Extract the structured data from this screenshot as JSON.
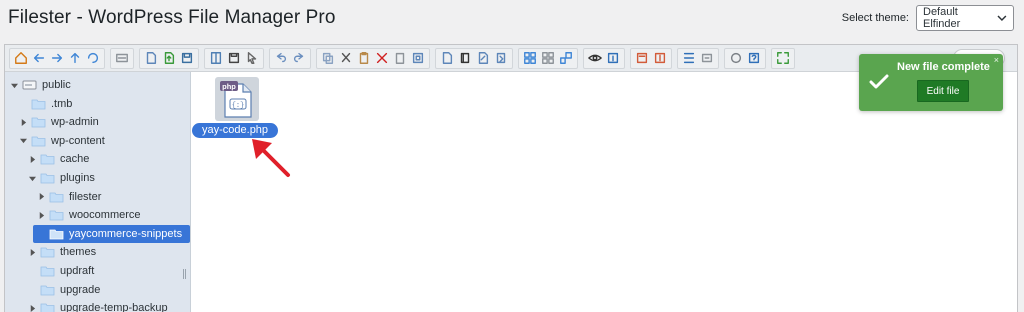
{
  "header": {
    "title": "Filester - WordPress File Manager Pro",
    "theme_label": "Select theme:",
    "theme_value": "Default Elfinder"
  },
  "toolbar": {
    "groups": [
      [
        "home-icon",
        "back-icon",
        "forward-icon",
        "up-icon",
        "reload-icon"
      ],
      [
        "mkdir-icon"
      ],
      [
        "mkfile-icon",
        "upload-icon",
        "save-icon"
      ],
      [
        "open-icon",
        "download-icon",
        "select-icon"
      ],
      [
        "undo-icon",
        "redo-icon"
      ],
      [
        "copy-icon",
        "cut-icon",
        "paste-icon",
        "delete-icon",
        "empty-icon",
        "duplicate-icon"
      ],
      [
        "rename-icon",
        "edit-icon",
        "resize-icon",
        "extract-icon"
      ],
      [
        "view-icons-icon",
        "view-list-icon",
        "sort-icon"
      ],
      [
        "preview-icon",
        "info-icon"
      ],
      [
        "archive-icon",
        "extract-archive-icon"
      ],
      [
        "places-icon",
        "netmount-icon"
      ],
      [
        "settings-icon",
        "help-icon"
      ],
      [
        "fullscreen-icon"
      ]
    ]
  },
  "tree": {
    "items": [
      {
        "label": "public",
        "depth": 0,
        "arrow": "open",
        "icon": "drive"
      },
      {
        "label": ".tmb",
        "depth": 1,
        "arrow": "none",
        "icon": "folder"
      },
      {
        "label": "wp-admin",
        "depth": 1,
        "arrow": "closed",
        "icon": "folder"
      },
      {
        "label": "wp-content",
        "depth": 1,
        "arrow": "open",
        "icon": "folder"
      },
      {
        "label": "cache",
        "depth": 2,
        "arrow": "closed",
        "icon": "folder"
      },
      {
        "label": "plugins",
        "depth": 2,
        "arrow": "open",
        "icon": "folder"
      },
      {
        "label": "filester",
        "depth": 3,
        "arrow": "closed",
        "icon": "folder"
      },
      {
        "label": "woocommerce",
        "depth": 3,
        "arrow": "closed",
        "icon": "folder"
      },
      {
        "label": "yaycommerce-snippets",
        "depth": 3,
        "arrow": "none",
        "icon": "folder-open",
        "selected": true
      },
      {
        "label": "themes",
        "depth": 2,
        "arrow": "closed",
        "icon": "folder"
      },
      {
        "label": "updraft",
        "depth": 2,
        "arrow": "none",
        "icon": "folder"
      },
      {
        "label": "upgrade",
        "depth": 2,
        "arrow": "none",
        "icon": "folder"
      },
      {
        "label": "upgrade-temp-backup",
        "depth": 2,
        "arrow": "closed",
        "icon": "folder"
      }
    ]
  },
  "files": [
    {
      "name": "yay-code.php",
      "type_badge": "php",
      "icon": "php-file-icon",
      "selected": true
    }
  ],
  "toast": {
    "message": "New file complete",
    "button_label": "Edit file",
    "close_glyph": "×"
  },
  "colors": {
    "selected": "#3875d7",
    "toast_bg": "#5aa54f",
    "toast_button": "#1f7a25",
    "annotation_arrow": "#e0202a"
  }
}
